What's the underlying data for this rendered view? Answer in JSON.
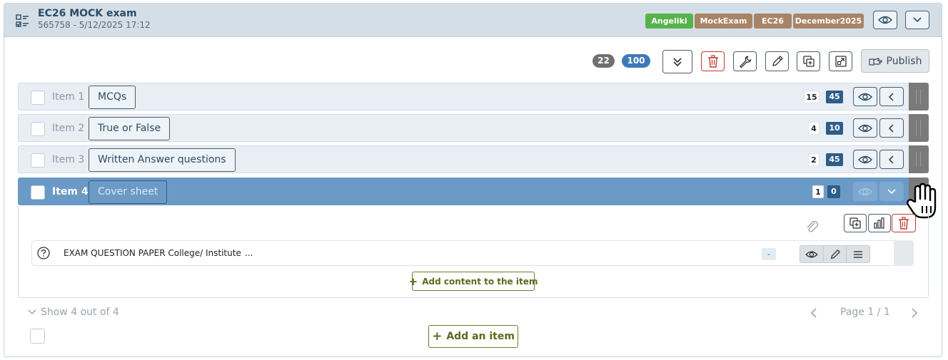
{
  "header": {
    "title": "EC26 MOCK exam",
    "subtitle": "565758 - 5/12/2025 17:12",
    "tags": [
      {
        "label": "Angeliki",
        "color": "green"
      },
      {
        "label": "MockExam",
        "color": "brown"
      },
      {
        "label": "EC26",
        "color": "brown"
      },
      {
        "label": "December2025",
        "color": "brown"
      }
    ]
  },
  "toolbar": {
    "count_gray": "22",
    "count_blue": "100",
    "publish_label": "Publish"
  },
  "items": [
    {
      "label": "Item 1",
      "name": "MCQs",
      "count_a": "15",
      "count_b": "45"
    },
    {
      "label": "Item 2",
      "name": "True or False",
      "count_a": "4",
      "count_b": "10"
    },
    {
      "label": "Item 3",
      "name": "Written Answer questions",
      "count_a": "2",
      "count_b": "45"
    },
    {
      "label": "Item 4",
      "name": "Cover sheet",
      "count_a": "1",
      "count_b": "0"
    }
  ],
  "expanded": {
    "content_text": "EXAM QUESTION PAPER College/ Institute",
    "content_ellipsis": "...",
    "content_dash": "-",
    "add_content_label": "Add content to the item"
  },
  "footer": {
    "show_label": "Show 4 out of 4",
    "page_label": "Page 1 / 1",
    "add_item_label": "Add an item"
  },
  "colors": {
    "header_bg": "#d4dee6",
    "active_row": "#6b9ac6",
    "tag_green": "#56b34b",
    "tag_brown": "#a88467",
    "count_blue": "#2d5d8a",
    "add_btn": "#5c6a1e",
    "delete_red": "#c0392b"
  }
}
